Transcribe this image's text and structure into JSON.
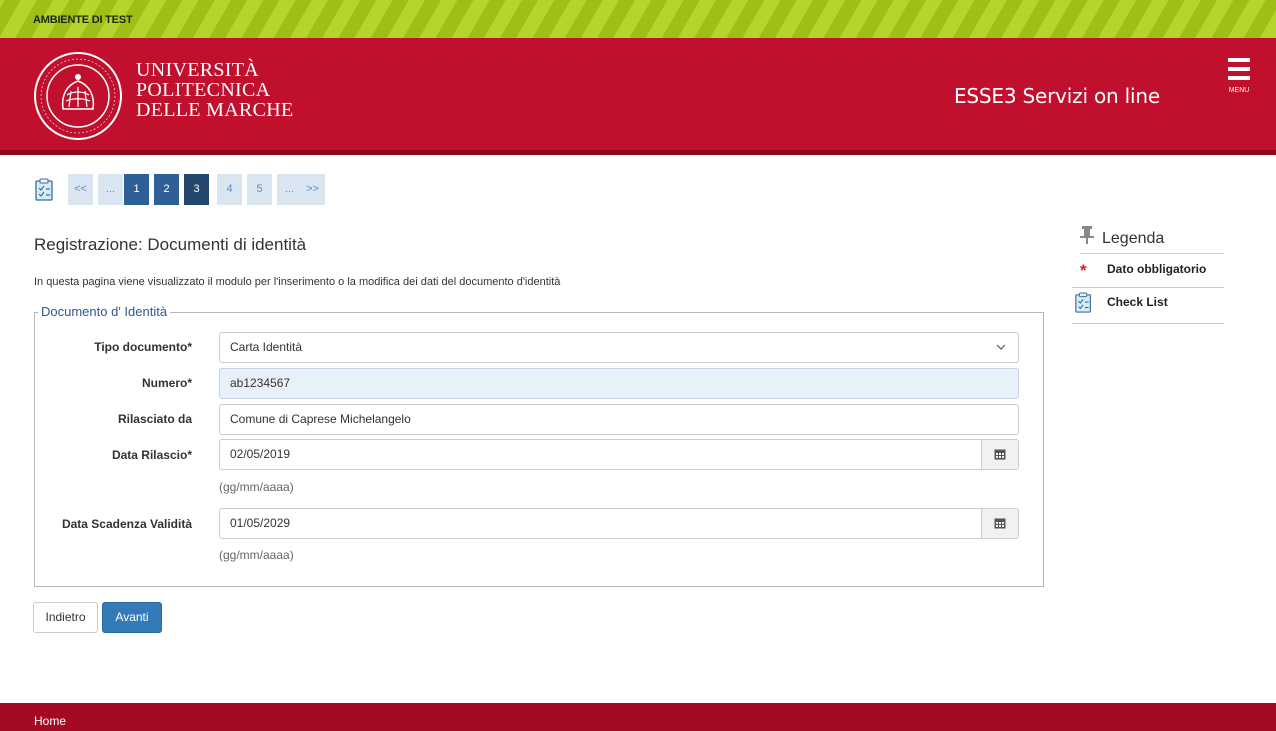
{
  "test_banner": {
    "label": "AMBIENTE DI TEST"
  },
  "header": {
    "logo_lines": [
      "UNIVERSITÀ",
      "POLITECNICA",
      "DELLE MARCHE"
    ],
    "seal_text": "UNIVERSITÀ POLITECNICA DELLE MARCHE",
    "app_title": "ESSE3 Servizi on line",
    "menu_label": "MENU"
  },
  "pager": {
    "icon": "checklist-icon",
    "items": [
      {
        "label": "<<",
        "state": "nav"
      },
      {
        "label": "...",
        "state": "nav"
      },
      {
        "label": "1",
        "state": "done"
      },
      {
        "label": "2",
        "state": "done"
      },
      {
        "label": "3",
        "state": "current"
      },
      {
        "label": "4",
        "state": "todo"
      },
      {
        "label": "5",
        "state": "todo"
      },
      {
        "label": "...",
        "state": "nav"
      },
      {
        "label": ">>",
        "state": "nav"
      }
    ]
  },
  "page": {
    "title": "Registrazione: Documenti di identità",
    "description": "In questa pagina viene visualizzato il modulo per l'inserimento o la modifica dei dati del documento d'identità"
  },
  "form": {
    "legend": "Documento d' Identità",
    "tipo_label": "Tipo documento*",
    "tipo_value": "Carta Identità",
    "numero_label": "Numero*",
    "numero_value": "ab1234567",
    "rilasciato_label": "Rilasciato da",
    "rilasciato_value": "Comune di Caprese Michelangelo",
    "data_rilascio_label": "Data Rilascio*",
    "data_rilascio_value": "02/05/2019",
    "data_rilascio_hint": "(gg/mm/aaaa)",
    "data_scadenza_label": "Data Scadenza Validità",
    "data_scadenza_value": "01/05/2029",
    "data_scadenza_hint": "(gg/mm/aaaa)"
  },
  "buttons": {
    "back": "Indietro",
    "next": "Avanti"
  },
  "legend": {
    "title": "Legenda",
    "items": [
      {
        "icon": "required-star-icon",
        "label": "Dato obbligatorio"
      },
      {
        "icon": "checklist-icon",
        "label": "Check List"
      }
    ]
  },
  "footer": {
    "home": "Home"
  },
  "colors": {
    "brand": "#c0102e",
    "test_banner": "#b5d52c",
    "primary_button": "#337ab7",
    "footer": "#a50a24"
  }
}
